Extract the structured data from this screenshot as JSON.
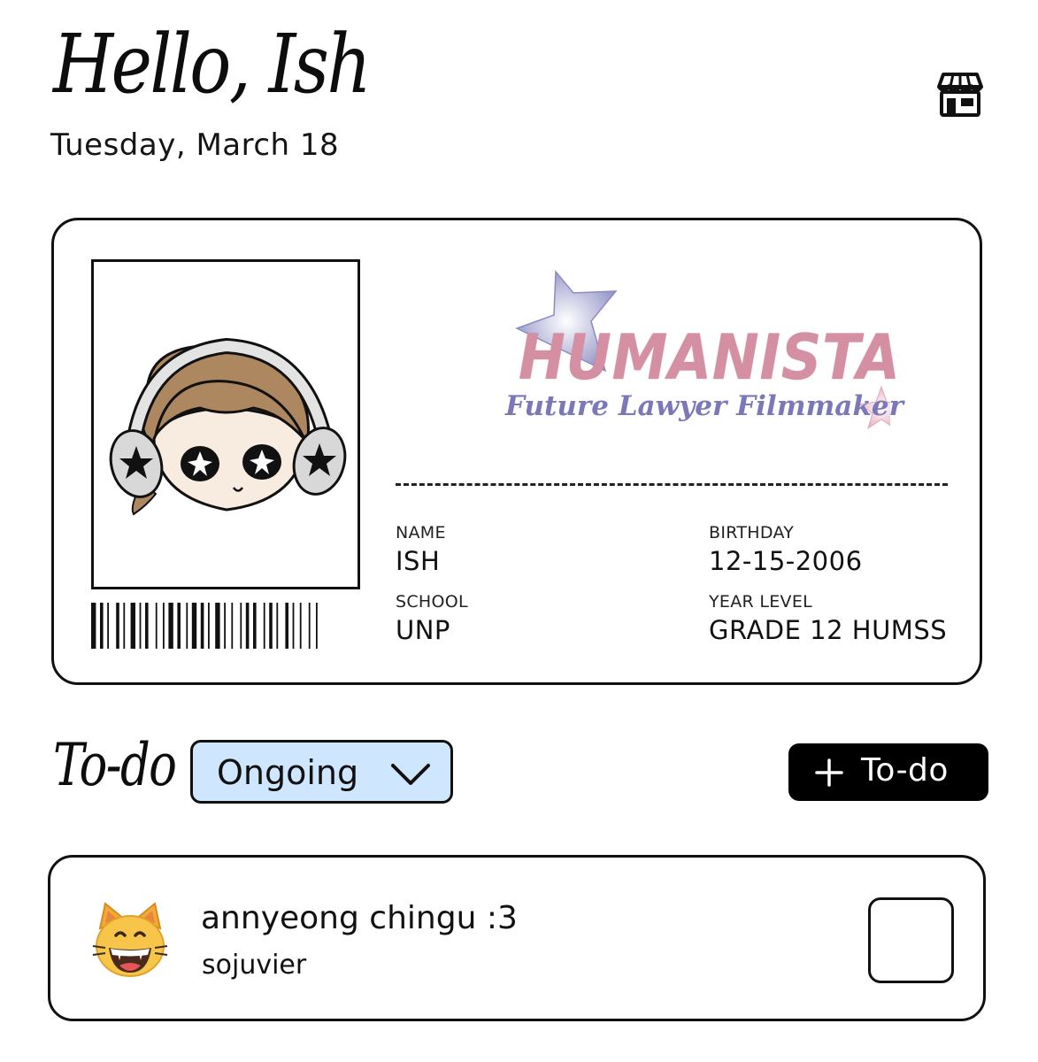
{
  "header": {
    "greeting": "Hello, Ish",
    "date": "Tuesday, March 18",
    "store_icon": "store-icon"
  },
  "id_card": {
    "logo": {
      "title": "HUMANISTA",
      "subtitle": "Future Lawyer Filmmaker"
    },
    "fields": {
      "name_label": "NAME",
      "name_value": "ISH",
      "birthday_label": "BIRTHDAY",
      "birthday_value": "12-15-2006",
      "school_label": "SCHOOL",
      "school_value": "UNP",
      "year_level_label": "YEAR LEVEL",
      "year_level_value": "GRADE 12 HUMSS"
    }
  },
  "todo": {
    "title": "To-do",
    "filter_value": "Ongoing",
    "add_label": "To-do",
    "items": [
      {
        "emoji": "grinning-cat-emoji",
        "title": "annyeong chingu :3",
        "author": "sojuvier",
        "checked": false
      }
    ]
  },
  "colors": {
    "filter_bg": "#cfe6ff",
    "logo_pink": "#d58fa3",
    "logo_purple": "#7a78b8",
    "add_button_bg": "#000000"
  }
}
